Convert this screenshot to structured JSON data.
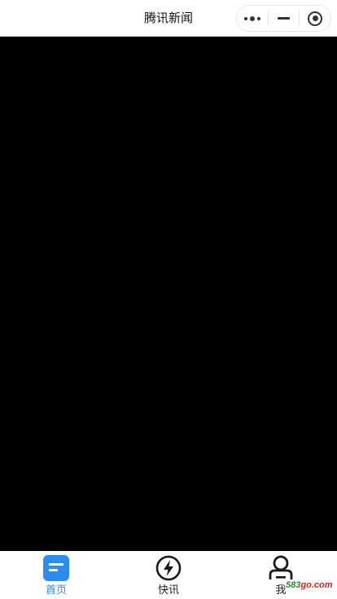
{
  "navbar": {
    "title": "腾讯新闻",
    "capsule": {
      "more_icon": "more-dots-icon",
      "minimize_icon": "minus-icon",
      "close_icon": "target-circle-icon"
    }
  },
  "content": {
    "background": "#000000"
  },
  "tabbar": {
    "active_color": "#2d8cf0",
    "tabs": [
      {
        "label": "首页",
        "icon": "home-list-icon",
        "active": true
      },
      {
        "label": "快讯",
        "icon": "lightning-bolt-icon",
        "active": false
      },
      {
        "label": "我",
        "icon": "user-profile-icon",
        "active": false
      }
    ]
  },
  "watermark": {
    "num": "583",
    "rest": "go.com"
  }
}
